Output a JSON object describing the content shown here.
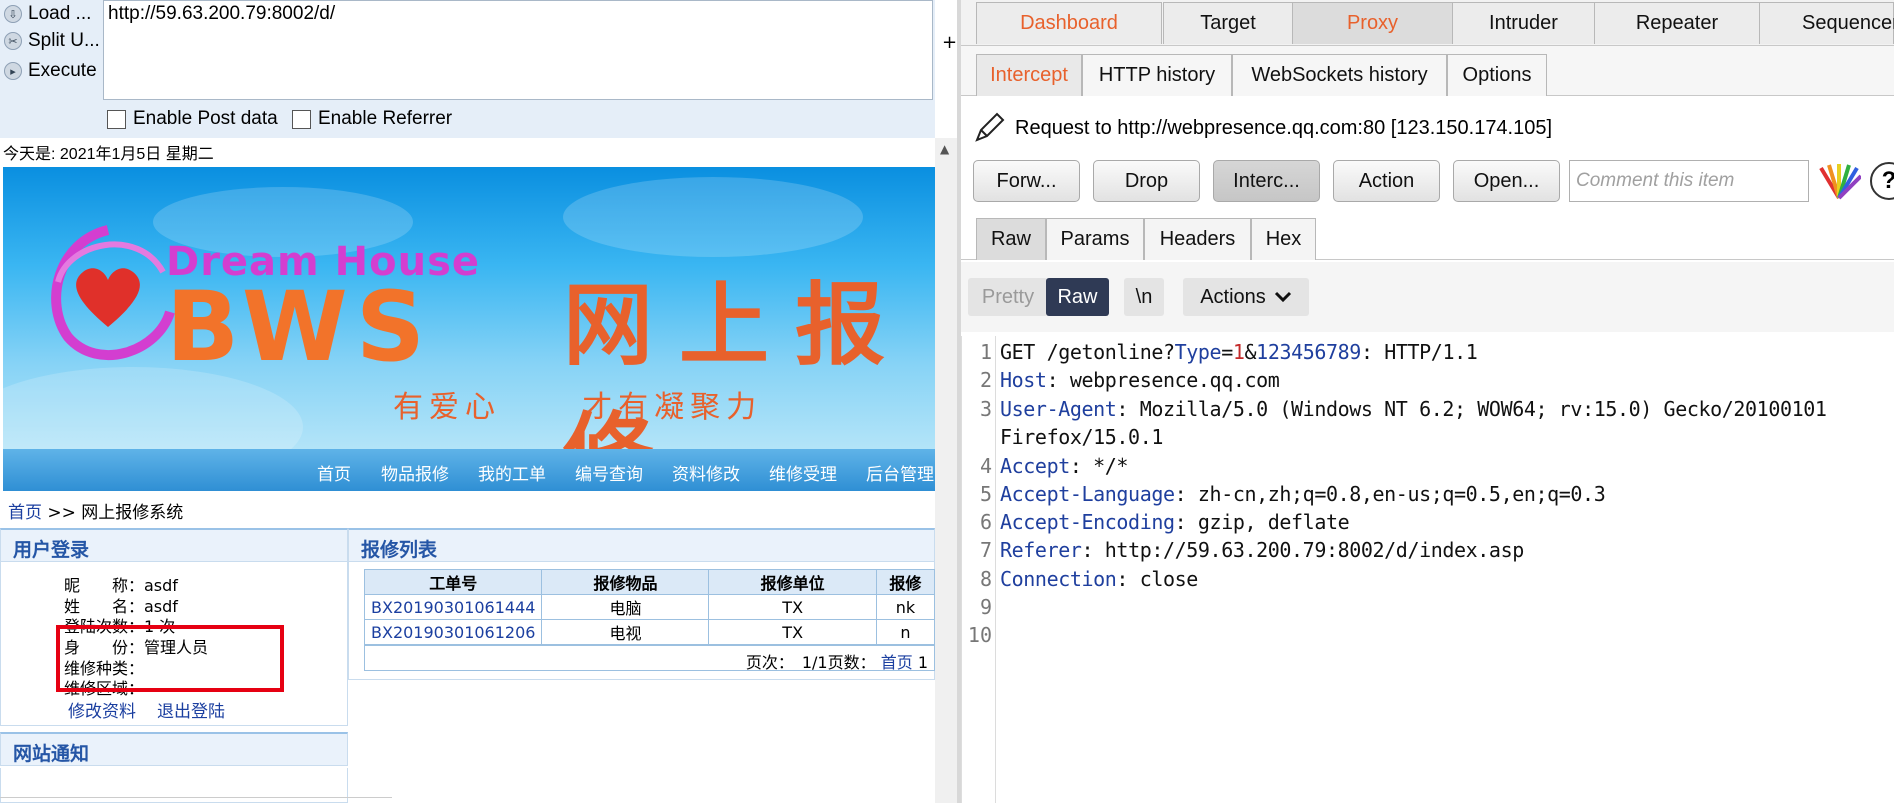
{
  "hackbar": {
    "load_label": "Load ...",
    "split_label": "Split U...",
    "execute_label": "Execute",
    "url": "http://59.63.200.79:8002/d/",
    "enable_post": "Enable Post data",
    "enable_referrer": "Enable Referrer",
    "plus": "+"
  },
  "page": {
    "date_line": "今天是: 2021年1月5日 星期二",
    "banner": {
      "dream": "Dream House",
      "bws": "BWS",
      "title_cn": "网上报修",
      "slogan_a": "有爱心",
      "slogan_b": "才有凝聚力"
    },
    "nav": [
      "首页",
      "物品报修",
      "我的工单",
      "编号查询",
      "资料修改",
      "维修受理",
      "后台管理"
    ],
    "breadcrumb": {
      "home": "首页",
      "sep": " >> ",
      "current": "网上报修系统"
    },
    "login": {
      "title": "用户登录",
      "rows": [
        "昵　　称：asdf",
        "姓　　名：asdf",
        "登陆次数：1 次",
        "身　　份：管理人员",
        "维修种类：",
        "维修区域："
      ],
      "edit_link": "修改资料",
      "logout_link": "退出登陆"
    },
    "notice": {
      "title": "网站通知"
    },
    "repair_list": {
      "title": "报修列表",
      "columns": [
        "工单号",
        "报修物品",
        "报修单位",
        "报修"
      ],
      "rows": [
        [
          "BX20190301061444",
          "电脑",
          "TX",
          "nk"
        ],
        [
          "BX20190301061206",
          "电视",
          "TX",
          "n"
        ]
      ],
      "pager_text": "页次：　1/1页数：",
      "pager_first": "首页",
      "pager_num": "1"
    }
  },
  "burp": {
    "top_tabs": [
      "Dashboard",
      "Target",
      "Proxy",
      "Intruder",
      "Repeater",
      "Sequencer"
    ],
    "sub_tabs": [
      "Intercept",
      "HTTP history",
      "WebSockets history",
      "Options"
    ],
    "request_line": "Request to http://webpresence.qq.com:80  [123.150.174.105]",
    "buttons": [
      "Forw...",
      "Drop",
      "Interc...",
      "Action",
      "Open..."
    ],
    "comment_placeholder": "Comment this item",
    "help": "?",
    "view_tabs": [
      "Raw",
      "Params",
      "Headers",
      "Hex"
    ],
    "editor": {
      "pretty": "Pretty",
      "raw": "Raw",
      "newline": "\\n",
      "actions": "Actions"
    },
    "line_numbers": [
      "1",
      "2",
      "3",
      "",
      "4",
      "5",
      "6",
      "7",
      "8",
      "9",
      "10"
    ],
    "request": {
      "l1_a": "GET /getonline?",
      "l1_k1": "Type",
      "l1_eq": "=",
      "l1_v1": "1",
      "l1_amp": "&",
      "l1_k2": "123456789",
      "l1_rest": ": HTTP/1.1",
      "host_k": "Host",
      "host_v": ": webpresence.qq.com",
      "ua_k": "User-Agent",
      "ua_v": ": Mozilla/5.0 (Windows NT 6.2; WOW64; rv:15.0) Gecko/20100101",
      "ua_v2": "Firefox/15.0.1",
      "accept_k": "Accept",
      "accept_v": ": */*",
      "lang_k": "Accept-Language",
      "lang_v": ": zh-cn,zh;q=0.8,en-us;q=0.5,en;q=0.3",
      "enc_k": "Accept-Encoding",
      "enc_v": ": gzip, deflate",
      "ref_k": "Referer",
      "ref_v": ": http://59.63.200.79:8002/d/index.asp",
      "conn_k": "Connection",
      "conn_v": ": close"
    }
  }
}
